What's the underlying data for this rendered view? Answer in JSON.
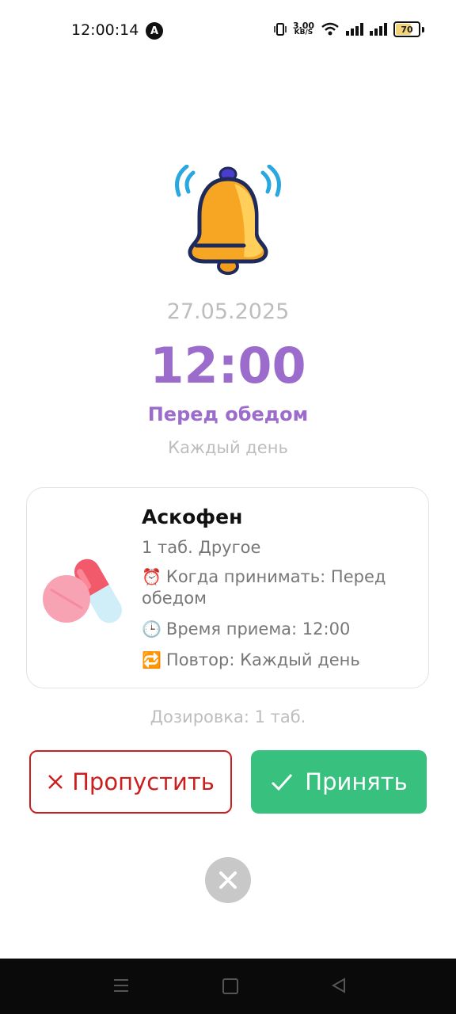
{
  "status_bar": {
    "time": "12:00:14",
    "app_icon": "A",
    "net_speed_value": "3.00",
    "net_speed_unit": "KB/S",
    "battery": "70",
    "icons": [
      "vibrate-icon",
      "wifi-icon",
      "signal-icon",
      "signal-icon",
      "battery-icon"
    ]
  },
  "reminder": {
    "date": "27.05.2025",
    "time": "12:00",
    "when_label": "Перед обедом",
    "repeat_label": "Каждый день"
  },
  "medication": {
    "name": "Аскофен",
    "subtitle": "1 таб. Другое",
    "when_line": "Когда принимать: Перед обедом",
    "time_line": "Время приема: 12:00",
    "repeat_line": "Повтор: Каждый день",
    "emoji_when": "⏰",
    "emoji_time": "🕒",
    "emoji_repeat": "🔁"
  },
  "dosage": "Дозировка: 1 таб.",
  "actions": {
    "skip_label": "Пропустить",
    "accept_label": "Принять"
  },
  "colors": {
    "accent": "#9b6ccc",
    "skip": "#cc1e1e",
    "accept": "#38c07f",
    "muted": "#bdbdbd"
  }
}
